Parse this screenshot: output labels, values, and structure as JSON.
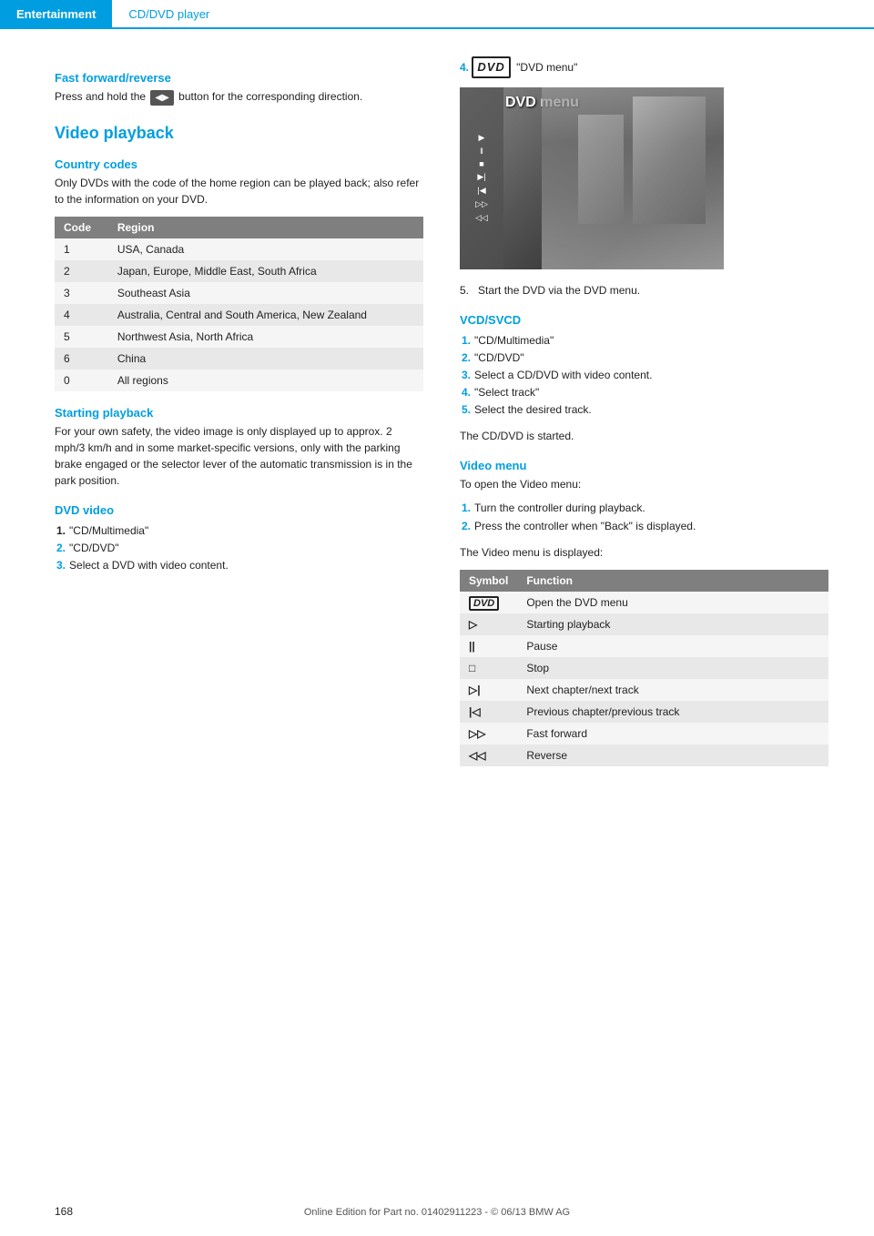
{
  "header": {
    "active_tab": "Entertainment",
    "section_label": "CD/DVD player"
  },
  "left_column": {
    "fast_forward": {
      "heading": "Fast forward/reverse",
      "body": "Press and hold the",
      "body2": "button for the corresponding direction."
    },
    "video_playback": {
      "heading": "Video playback"
    },
    "country_codes": {
      "heading": "Country codes",
      "description": "Only DVDs with the code of the home region can be played back; also refer to the information on your DVD.",
      "table": {
        "col1": "Code",
        "col2": "Region",
        "rows": [
          {
            "code": "1",
            "region": "USA, Canada"
          },
          {
            "code": "2",
            "region": "Japan, Europe, Middle East, South Africa"
          },
          {
            "code": "3",
            "region": "Southeast Asia"
          },
          {
            "code": "4",
            "region": "Australia, Central and South America, New Zealand"
          },
          {
            "code": "5",
            "region": "Northwest Asia, North Africa"
          },
          {
            "code": "6",
            "region": "China"
          },
          {
            "code": "0",
            "region": "All regions"
          }
        ]
      }
    },
    "starting_playback": {
      "heading": "Starting playback",
      "description": "For your own safety, the video image is only displayed up to approx. 2 mph/3 km/h and in some market-specific versions, only with the parking brake engaged or the selector lever of the automatic transmission is in the park position."
    },
    "dvd_video": {
      "heading": "DVD video",
      "steps": [
        {
          "num": "1.",
          "text": "\"CD/Multimedia\""
        },
        {
          "num": "2.",
          "text": "\"CD/DVD\""
        },
        {
          "num": "3.",
          "text": "Select a DVD with video content."
        }
      ]
    }
  },
  "right_column": {
    "step4_label": "\"DVD menu\"",
    "step5_label": "Start the DVD via the DVD menu.",
    "vcd_svcd": {
      "heading": "VCD/SVCD",
      "steps": [
        {
          "num": "1.",
          "text": "\"CD/Multimedia\""
        },
        {
          "num": "2.",
          "text": "\"CD/DVD\""
        },
        {
          "num": "3.",
          "text": "Select a CD/DVD with video content."
        },
        {
          "num": "4.",
          "text": "\"Select track\""
        },
        {
          "num": "5.",
          "text": "Select the desired track."
        }
      ],
      "note": "The CD/DVD is started."
    },
    "video_menu": {
      "heading": "Video menu",
      "intro": "To open the Video menu:",
      "steps": [
        {
          "num": "1.",
          "text": "Turn the controller during playback."
        },
        {
          "num": "2.",
          "text": "Press the controller when \"Back\" is displayed."
        }
      ],
      "note": "The Video menu is displayed:",
      "table": {
        "col1": "Symbol",
        "col2": "Function",
        "rows": [
          {
            "symbol": "DVD",
            "function": "Open the DVD menu"
          },
          {
            "symbol": "▷",
            "function": "Starting playback"
          },
          {
            "symbol": "||",
            "function": "Pause"
          },
          {
            "symbol": "□",
            "function": "Stop"
          },
          {
            "symbol": "▷|",
            "function": "Next chapter/next track"
          },
          {
            "symbol": "|◁",
            "function": "Previous chapter/previous track"
          },
          {
            "symbol": "▷▷",
            "function": "Fast forward"
          },
          {
            "symbol": "◁◁",
            "function": "Reverse"
          }
        ]
      }
    }
  },
  "footer": {
    "page_number": "168",
    "copyright": "Online Edition for Part no. 01402911223 - © 06/13 BMW AG"
  }
}
